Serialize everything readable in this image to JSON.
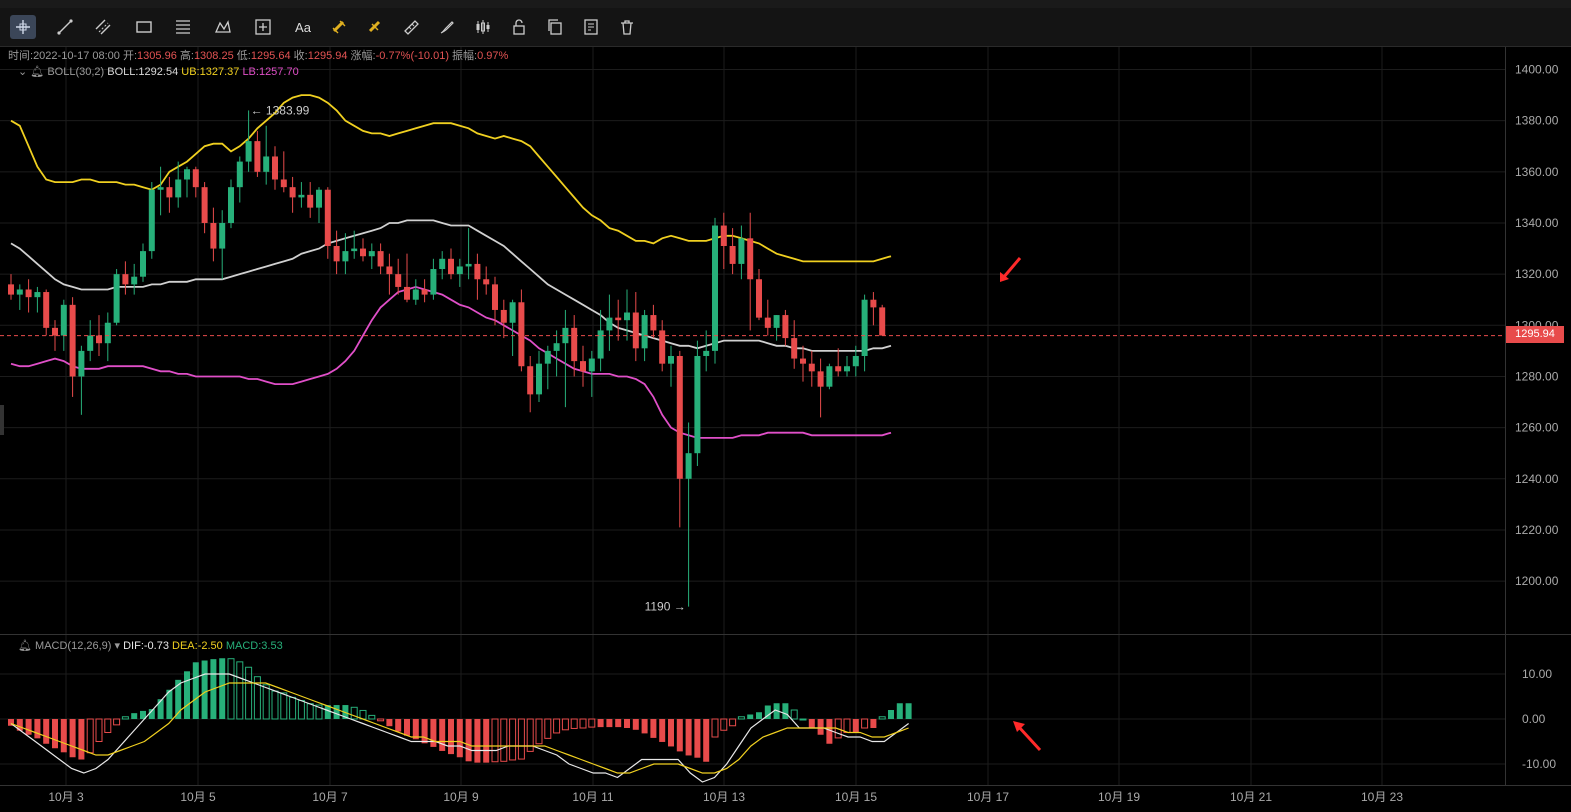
{
  "toolbar": {
    "tools": [
      {
        "name": "crosshair-icon",
        "active": true
      },
      {
        "name": "trend-line-icon"
      },
      {
        "name": "parallel-channel-icon"
      },
      {
        "name": "rectangle-icon"
      },
      {
        "name": "fibonacci-icon"
      },
      {
        "name": "pattern-icon"
      },
      {
        "name": "measure-icon"
      },
      {
        "name": "text-icon",
        "label": "Aa"
      },
      {
        "name": "magnet-icon",
        "highlight": true
      },
      {
        "name": "lock-drawings-icon",
        "highlight": true
      },
      {
        "name": "ruler-icon"
      },
      {
        "name": "brush-icon"
      },
      {
        "name": "candles-icon"
      },
      {
        "name": "lock-icon"
      },
      {
        "name": "copy-icon"
      },
      {
        "name": "settings-icon"
      },
      {
        "name": "trash-icon"
      }
    ]
  },
  "info": {
    "time_label": "时间:",
    "time": "2022-10-17 08:00",
    "open_label": "开:",
    "open": "1305.96",
    "high_label": "高:",
    "high": "1308.25",
    "low_label": "低:",
    "low": "1295.64",
    "close_label": "收:",
    "close": "1295.94",
    "change_label": "涨幅:",
    "change": "-0.77%(-10.01)",
    "amp_label": "振幅:",
    "amp": "0.97%"
  },
  "boll": {
    "name": "BOLL(30,2)",
    "mid": "BOLL:1292.54",
    "ub": "UB:1327.37",
    "lb": "LB:1257.70"
  },
  "macd": {
    "name": "MACD(12,26,9)",
    "dif": "DIF:-0.73",
    "dea": "DEA:-2.50",
    "macd": "MACD:3.53"
  },
  "price_axis": [
    "1400.00",
    "1380.00",
    "1360.00",
    "1340.00",
    "1320.00",
    "1300.00",
    "1280.00",
    "1260.00",
    "1240.00",
    "1220.00",
    "1200.00"
  ],
  "macd_axis": [
    "10.00",
    "0.00",
    "-10.00"
  ],
  "dates": [
    "10月 3",
    "10月 5",
    "10月 7",
    "10月 9",
    "10月 11",
    "10月 13",
    "10月 15",
    "10月 17",
    "10月 19",
    "10月 21",
    "10月 23"
  ],
  "current_price": "1295.94",
  "annotations": {
    "high": "1383.99",
    "low": "1190"
  },
  "colors": {
    "up": "#27b07a",
    "down": "#e84b4b",
    "mid": "#d0d0d0",
    "ub": "#f0d020",
    "lb": "#e04fc8"
  },
  "chart_data": {
    "type": "candlestick",
    "ylim": [
      1185,
      1405
    ],
    "candles": [
      [
        1316,
        1320,
        1310,
        1312
      ],
      [
        1312,
        1316,
        1306,
        1314
      ],
      [
        1314,
        1318,
        1305,
        1311
      ],
      [
        1311,
        1315,
        1305,
        1313
      ],
      [
        1313,
        1314,
        1296,
        1299
      ],
      [
        1299,
        1302,
        1290,
        1296
      ],
      [
        1296,
        1310,
        1290,
        1308
      ],
      [
        1308,
        1311,
        1272,
        1280
      ],
      [
        1280,
        1292,
        1265,
        1290
      ],
      [
        1290,
        1302,
        1286,
        1296
      ],
      [
        1296,
        1304,
        1288,
        1293
      ],
      [
        1293,
        1305,
        1286,
        1301
      ],
      [
        1301,
        1322,
        1300,
        1320
      ],
      [
        1320,
        1325,
        1312,
        1316
      ],
      [
        1316,
        1324,
        1312,
        1319
      ],
      [
        1319,
        1332,
        1317,
        1329
      ],
      [
        1329,
        1356,
        1326,
        1353
      ],
      [
        1353,
        1362,
        1343,
        1354
      ],
      [
        1354,
        1358,
        1344,
        1350
      ],
      [
        1350,
        1364,
        1346,
        1357
      ],
      [
        1357,
        1362,
        1350,
        1361
      ],
      [
        1361,
        1362,
        1350,
        1354
      ],
      [
        1354,
        1356,
        1336,
        1340
      ],
      [
        1340,
        1346,
        1325,
        1330
      ],
      [
        1330,
        1345,
        1318,
        1340
      ],
      [
        1340,
        1357,
        1338,
        1354
      ],
      [
        1354,
        1366,
        1348,
        1364
      ],
      [
        1364,
        1384,
        1360,
        1372
      ],
      [
        1372,
        1376,
        1358,
        1360
      ],
      [
        1360,
        1378,
        1355,
        1366
      ],
      [
        1366,
        1370,
        1353,
        1357
      ],
      [
        1357,
        1368,
        1352,
        1354
      ],
      [
        1354,
        1358,
        1344,
        1350
      ],
      [
        1350,
        1356,
        1346,
        1351
      ],
      [
        1351,
        1356,
        1342,
        1346
      ],
      [
        1346,
        1354,
        1340,
        1353
      ],
      [
        1353,
        1354,
        1326,
        1331
      ],
      [
        1331,
        1337,
        1320,
        1325
      ],
      [
        1325,
        1336,
        1320,
        1329
      ],
      [
        1329,
        1337,
        1326,
        1330
      ],
      [
        1330,
        1334,
        1325,
        1327
      ],
      [
        1327,
        1332,
        1322,
        1329
      ],
      [
        1329,
        1332,
        1320,
        1323
      ],
      [
        1323,
        1328,
        1312,
        1320
      ],
      [
        1320,
        1326,
        1312,
        1315
      ],
      [
        1315,
        1328,
        1309,
        1310
      ],
      [
        1310,
        1318,
        1308,
        1314
      ],
      [
        1314,
        1318,
        1309,
        1312
      ],
      [
        1312,
        1326,
        1310,
        1322
      ],
      [
        1322,
        1329,
        1318,
        1326
      ],
      [
        1326,
        1330,
        1318,
        1320
      ],
      [
        1320,
        1326,
        1315,
        1323
      ],
      [
        1323,
        1338,
        1318,
        1324
      ],
      [
        1324,
        1328,
        1310,
        1318
      ],
      [
        1318,
        1323,
        1312,
        1316
      ],
      [
        1316,
        1319,
        1300,
        1306
      ],
      [
        1306,
        1310,
        1295,
        1301
      ],
      [
        1301,
        1310,
        1288,
        1309
      ],
      [
        1309,
        1314,
        1282,
        1284
      ],
      [
        1284,
        1288,
        1266,
        1273
      ],
      [
        1273,
        1290,
        1270,
        1285
      ],
      [
        1285,
        1292,
        1275,
        1290
      ],
      [
        1290,
        1298,
        1280,
        1293
      ],
      [
        1293,
        1306,
        1268,
        1299
      ],
      [
        1299,
        1304,
        1280,
        1286
      ],
      [
        1286,
        1292,
        1276,
        1282
      ],
      [
        1282,
        1290,
        1272,
        1287
      ],
      [
        1287,
        1306,
        1282,
        1298
      ],
      [
        1298,
        1312,
        1290,
        1303
      ],
      [
        1303,
        1310,
        1294,
        1302
      ],
      [
        1302,
        1314,
        1294,
        1305
      ],
      [
        1305,
        1313,
        1286,
        1291
      ],
      [
        1291,
        1306,
        1286,
        1304
      ],
      [
        1304,
        1308,
        1295,
        1298
      ],
      [
        1298,
        1302,
        1282,
        1285
      ],
      [
        1285,
        1292,
        1276,
        1288
      ],
      [
        1288,
        1290,
        1221,
        1240
      ],
      [
        1240,
        1262,
        1190,
        1250
      ],
      [
        1250,
        1294,
        1245,
        1288
      ],
      [
        1288,
        1298,
        1282,
        1290
      ],
      [
        1290,
        1342,
        1285,
        1339
      ],
      [
        1339,
        1344,
        1322,
        1331
      ],
      [
        1331,
        1338,
        1320,
        1324
      ],
      [
        1324,
        1339,
        1318,
        1334
      ],
      [
        1334,
        1344,
        1298,
        1318
      ],
      [
        1318,
        1322,
        1302,
        1303
      ],
      [
        1303,
        1310,
        1296,
        1299
      ],
      [
        1299,
        1304,
        1294,
        1304
      ],
      [
        1304,
        1306,
        1292,
        1295
      ],
      [
        1295,
        1302,
        1283,
        1287
      ],
      [
        1287,
        1292,
        1278,
        1285
      ],
      [
        1285,
        1290,
        1276,
        1282
      ],
      [
        1282,
        1287,
        1264,
        1276
      ],
      [
        1276,
        1285,
        1275,
        1284
      ],
      [
        1284,
        1291,
        1280,
        1282
      ],
      [
        1282,
        1288,
        1280,
        1284
      ],
      [
        1284,
        1292,
        1280,
        1288
      ],
      [
        1288,
        1312,
        1282,
        1310
      ],
      [
        1310,
        1313,
        1300,
        1307
      ],
      [
        1307,
        1308,
        1296,
        1296
      ]
    ],
    "boll_mid": [
      1332,
      1330,
      1327,
      1324,
      1321,
      1318,
      1316,
      1315,
      1314,
      1314,
      1314,
      1314,
      1315,
      1315,
      1315,
      1315,
      1316,
      1316,
      1317,
      1317,
      1317,
      1318,
      1318,
      1318,
      1318,
      1319,
      1320,
      1321,
      1322,
      1323,
      1324,
      1325,
      1326,
      1328,
      1329,
      1330,
      1332,
      1333,
      1334,
      1335,
      1336,
      1337,
      1338,
      1340,
      1340,
      1341,
      1341,
      1341,
      1341,
      1340,
      1339,
      1339,
      1339,
      1337,
      1335,
      1333,
      1331,
      1328,
      1325,
      1322,
      1319,
      1316,
      1314,
      1312,
      1310,
      1308,
      1306,
      1304,
      1301,
      1299,
      1298,
      1297,
      1296,
      1295,
      1294,
      1293,
      1292,
      1292,
      1291,
      1292,
      1293,
      1294,
      1294,
      1294,
      1294,
      1294,
      1293,
      1292,
      1292,
      1291,
      1291,
      1290,
      1290,
      1290,
      1290,
      1290,
      1290,
      1290,
      1291,
      1291,
      1292
    ],
    "boll_ub": [
      1380,
      1378,
      1370,
      1362,
      1357,
      1356,
      1356,
      1356,
      1357,
      1357,
      1356,
      1356,
      1356,
      1355,
      1355,
      1354,
      1353,
      1355,
      1360,
      1362,
      1364,
      1367,
      1370,
      1371,
      1371,
      1368,
      1370,
      1373,
      1377,
      1380,
      1383,
      1387,
      1389,
      1390,
      1390,
      1389,
      1387,
      1384,
      1380,
      1378,
      1376,
      1375,
      1375,
      1374,
      1375,
      1376,
      1377,
      1378,
      1379,
      1379,
      1379,
      1378,
      1377,
      1375,
      1374,
      1373,
      1374,
      1373,
      1372,
      1370,
      1366,
      1362,
      1358,
      1354,
      1350,
      1346,
      1343,
      1341,
      1338,
      1337,
      1335,
      1333,
      1333,
      1332,
      1334,
      1335,
      1334,
      1333,
      1333,
      1333,
      1334,
      1335,
      1335,
      1334,
      1333,
      1332,
      1330,
      1328,
      1327,
      1326,
      1325,
      1325,
      1325,
      1325,
      1325,
      1325,
      1325,
      1325,
      1325,
      1326,
      1327
    ],
    "boll_lb": [
      1285,
      1284,
      1284,
      1285,
      1286,
      1287,
      1286,
      1284,
      1283,
      1283,
      1283,
      1284,
      1284,
      1284,
      1284,
      1284,
      1283,
      1282,
      1282,
      1281,
      1281,
      1280,
      1280,
      1280,
      1280,
      1280,
      1280,
      1279,
      1279,
      1278,
      1277,
      1277,
      1277,
      1278,
      1279,
      1280,
      1281,
      1283,
      1286,
      1290,
      1296,
      1302,
      1307,
      1310,
      1313,
      1314,
      1315,
      1314,
      1313,
      1312,
      1310,
      1308,
      1307,
      1305,
      1303,
      1302,
      1300,
      1298,
      1296,
      1294,
      1291,
      1289,
      1287,
      1285,
      1283,
      1282,
      1281,
      1281,
      1281,
      1280,
      1280,
      1279,
      1277,
      1272,
      1265,
      1260,
      1258,
      1257,
      1256,
      1256,
      1256,
      1256,
      1256,
      1257,
      1257,
      1257,
      1258,
      1258,
      1258,
      1258,
      1258,
      1257,
      1257,
      1257,
      1257,
      1257,
      1257,
      1257,
      1257,
      1257,
      1258
    ],
    "macd_hist": [
      -1.5,
      -2.6,
      -3.5,
      -4.3,
      -5.5,
      -6.5,
      -7.4,
      -8.5,
      -9,
      -7.5,
      -5,
      -3,
      -1.3,
      0.5,
      1.3,
      1.8,
      2.2,
      4.4,
      6.5,
      8.7,
      10.6,
      12.6,
      13,
      13.3,
      13.5,
      13.4,
      12.7,
      11.5,
      9.4,
      7.6,
      6.2,
      5.8,
      4.8,
      4.1,
      3.4,
      3.1,
      3.1,
      3.1,
      3.1,
      2.6,
      1.9,
      0.8,
      -0.4,
      -1.6,
      -2.8,
      -3.7,
      -4.5,
      -5.4,
      -6.2,
      -7.1,
      -7.8,
      -8.5,
      -9.4,
      -9.7,
      -9.7,
      -9.5,
      -9.4,
      -9.1,
      -8.9,
      -7.2,
      -5.5,
      -4.3,
      -3.1,
      -2.4,
      -2.1,
      -2,
      -1.8,
      -1.8,
      -1.8,
      -1.8,
      -2,
      -2.4,
      -3.2,
      -4.2,
      -5.1,
      -6.1,
      -7.2,
      -8.1,
      -8.6,
      -9.5,
      -4,
      -2.5,
      -1.5,
      0.5,
      1,
      1.5,
      3,
      3.5,
      3.5,
      2,
      0,
      -2,
      -3.5,
      -5.5,
      -4.2,
      -3,
      -3,
      -2,
      -2,
      0.5,
      2,
      3.5,
      3.5
    ],
    "macd_dif": [
      -1,
      -3,
      -5,
      -7,
      -9,
      -11,
      -12,
      -11,
      -9,
      -6,
      -3,
      0,
      3,
      6,
      8,
      9,
      10,
      10,
      10,
      9,
      8,
      7,
      6,
      5,
      4,
      3,
      2,
      1,
      0,
      -1,
      -2,
      -3,
      -4,
      -5,
      -5,
      -5,
      -6,
      -6,
      -7,
      -7,
      -7,
      -6,
      -6,
      -6,
      -7,
      -8,
      -10,
      -11,
      -12,
      -12,
      -13,
      -11,
      -9,
      -9,
      -9,
      -9,
      -12,
      -14,
      -13,
      -10,
      -6,
      -2,
      0,
      2,
      1,
      -2,
      -2,
      -2,
      -3,
      -4,
      -4,
      -5,
      -5,
      -3,
      -1
    ],
    "macd_dea": [
      -1,
      -2,
      -3,
      -4,
      -5,
      -6,
      -7,
      -8,
      -8,
      -7,
      -6,
      -5,
      -3,
      -1,
      2,
      4,
      6,
      7,
      8,
      8,
      8,
      8,
      7,
      6,
      5,
      4,
      3,
      2,
      1,
      0,
      -1,
      -2,
      -3,
      -4,
      -4,
      -5,
      -5,
      -5,
      -6,
      -6,
      -6,
      -6,
      -6,
      -6,
      -6,
      -7,
      -8,
      -9,
      -10,
      -11,
      -12,
      -12,
      -11,
      -10,
      -10,
      -10,
      -11,
      -12,
      -12,
      -11,
      -9,
      -6,
      -4,
      -3,
      -2,
      -2,
      -2,
      -2,
      -2,
      -3,
      -3,
      -4,
      -4,
      -3,
      -2
    ]
  }
}
